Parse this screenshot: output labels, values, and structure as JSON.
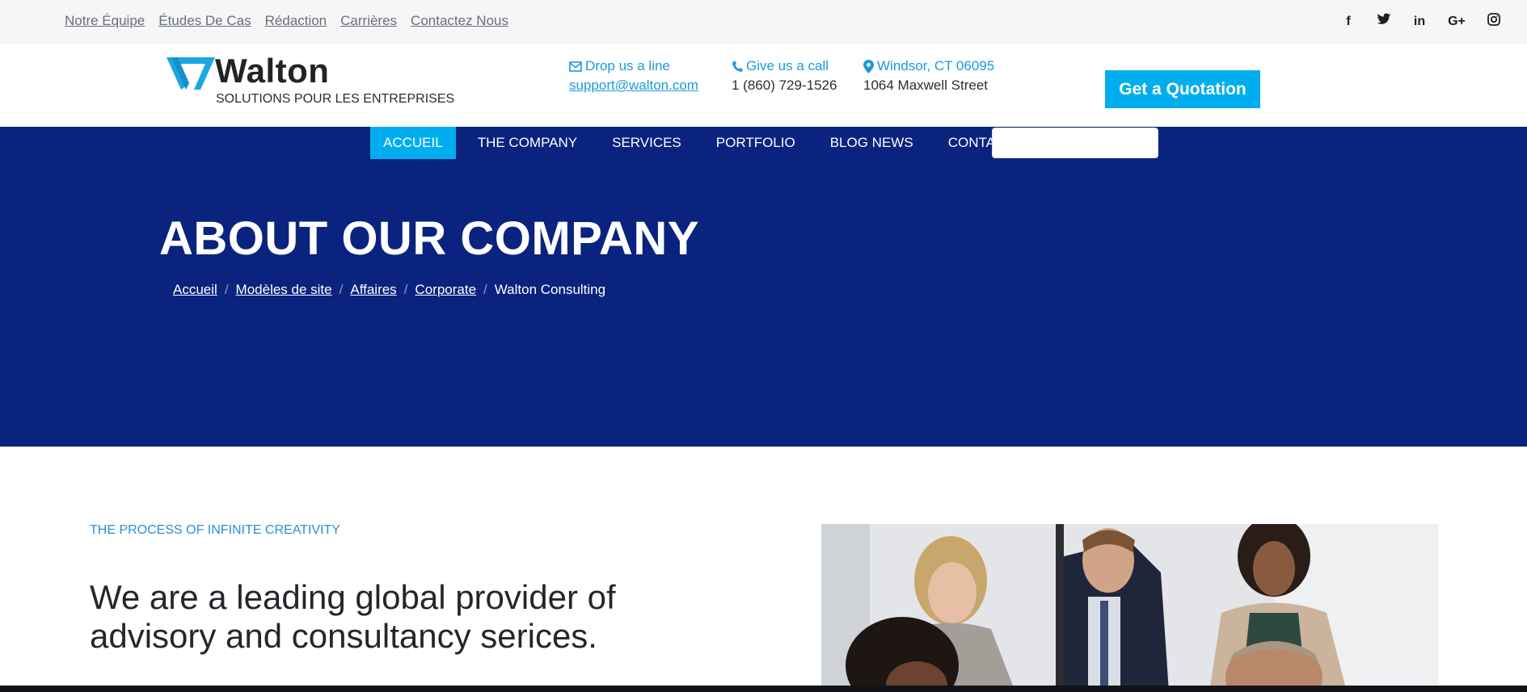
{
  "topbar": {
    "links": [
      "Notre Équipe",
      "Études De Cas",
      "Rédaction",
      "Carrières",
      "Contactez Nous"
    ],
    "socials": [
      {
        "name": "facebook-icon",
        "glyph": "f"
      },
      {
        "name": "twitter-icon",
        "glyph": "🐦"
      },
      {
        "name": "linkedin-icon",
        "glyph": "in"
      },
      {
        "name": "google-plus-icon",
        "glyph": "G+"
      },
      {
        "name": "instagram-icon",
        "glyph": "◎"
      }
    ]
  },
  "header": {
    "logo_name": "Walton",
    "logo_tagline": "SOLUTIONS POUR LES ENTREPRISES",
    "contacts": [
      {
        "icon": "envelope-icon",
        "title": "Drop us a line",
        "value": "support@walton.com",
        "is_link": true
      },
      {
        "icon": "phone-icon",
        "title": "Give us a call",
        "value": "1 (860) 729-1526",
        "is_link": false
      },
      {
        "icon": "map-pin-icon",
        "title": "Windsor, CT 06095",
        "value": "1064 Maxwell Street",
        "is_link": false
      }
    ],
    "quote_button": "Get a Quotation"
  },
  "nav": {
    "items": [
      "ACCUEIL",
      "THE COMPANY",
      "SERVICES",
      "PORTFOLIO",
      "BLOG NEWS",
      "CONTACTS"
    ],
    "active_index": 0
  },
  "hero": {
    "title": "ABOUT OUR COMPANY",
    "breadcrumbs": [
      "Accueil",
      "Modèles de site",
      "Affaires",
      "Corporate"
    ],
    "breadcrumb_current": "Walton Consulting"
  },
  "content": {
    "kicker": "THE PROCESS OF INFINITE CREATIVITY",
    "headline": "We are a leading global provider of advisory and consultancy serices."
  },
  "colors": {
    "accent": "#00aeef",
    "hero_bg": "#0a237e",
    "link_blue": "#1a9bd7"
  }
}
